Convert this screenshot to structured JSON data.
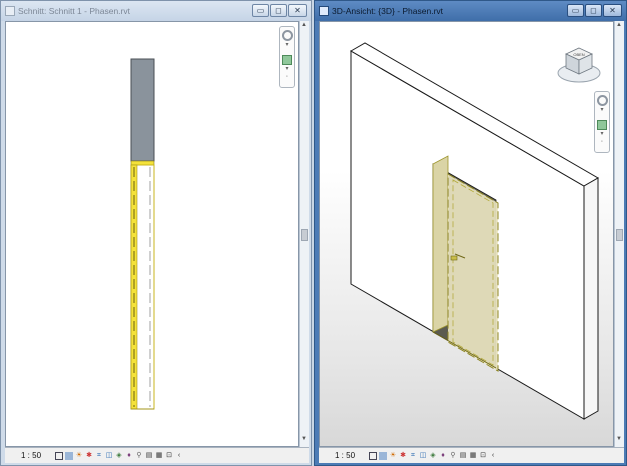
{
  "left_window": {
    "title": "Schnitt: Schnitt 1 - Phasen.rvt",
    "scale": "1 : 50",
    "icons": [
      "sun-path-icon",
      "detail-level-icon",
      "visual-style-icon",
      "shadows-icon",
      "crop-icon",
      "show-crop-icon",
      "temporary-hide-icon",
      "reveal-hidden-icon",
      "lock-view-icon",
      "analysis-icon"
    ]
  },
  "right_window": {
    "title": "3D-Ansicht: {3D} - Phasen.rvt",
    "scale": "1 : 50"
  },
  "controls": {
    "minimize": "▭",
    "maximize": "◻",
    "close": "✕"
  },
  "colors": {
    "cut_wall_gray": "#8a939c",
    "demolished_yellow": "#f4e23a",
    "door_fill": "#ece7c2"
  }
}
